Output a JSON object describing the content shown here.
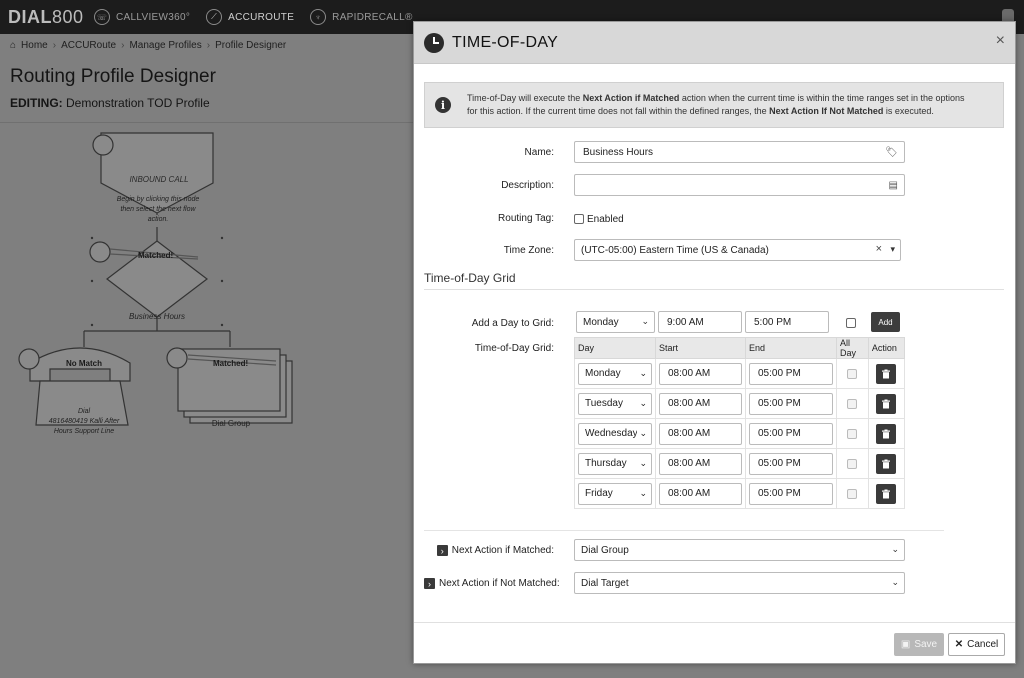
{
  "topbar": {
    "brand_a": "DIAL",
    "brand_b": "800",
    "nav": [
      {
        "label": "CALLVIEW360°",
        "icon": "callview-icon"
      },
      {
        "label": "ACCUROUTE",
        "icon": "accuroute-icon"
      },
      {
        "label": "RAPIDRECALL®",
        "icon": "rapidrecall-icon"
      }
    ]
  },
  "breadcrumb": [
    "Home",
    "ACCURoute",
    "Manage Profiles",
    "Profile Designer"
  ],
  "page": {
    "title": "Routing Profile Designer",
    "editing_label": "EDITING:",
    "editing_value": "Demonstration TOD Profile"
  },
  "flow": {
    "inbound_title": "INBOUND CALL",
    "inbound_text": [
      "Begin by clicking this node",
      "then select the next flow",
      "action."
    ],
    "matched_top": "Matched!",
    "decision_label": "Business Hours",
    "no_match": "No Match",
    "matched_right": "Matched!",
    "dial_text": [
      "Dial",
      "4816480419 Kalli After",
      "Hours Support Line"
    ],
    "dial_group": "Dial Group"
  },
  "modal": {
    "title": "TIME-OF-DAY",
    "close": "×",
    "info_1": "Time-of-Day will execute the ",
    "info_b1": "Next Action if Matched",
    "info_2": " action when the current time is within the time ranges set in the options",
    "info_3": "for this action. If the current time does not fall within the defined ranges, the ",
    "info_b2": "Next Action If Not Matched",
    "info_4": " is executed.",
    "name_label": "Name:",
    "name_value": "Business Hours",
    "desc_label": "Description:",
    "desc_value": "",
    "tag_label": "Routing Tag:",
    "tag_enabled": "Enabled",
    "tz_label": "Time Zone:",
    "tz_value": "(UTC-05:00) Eastern Time (US & Canada)",
    "tz_clear": "×",
    "section_title": "Time-of-Day Grid",
    "add_label": "Add a Day to Grid:",
    "add_day": "Monday",
    "add_start": "9:00 AM",
    "add_end": "5:00 PM",
    "add_button": "Add",
    "grid_label": "Time-of-Day Grid:",
    "grid_headers": [
      "Day",
      "Start",
      "End",
      "All Day",
      "Action"
    ],
    "grid_rows": [
      {
        "day": "Monday",
        "start": "08:00 AM",
        "end": "05:00 PM"
      },
      {
        "day": "Tuesday",
        "start": "08:00 AM",
        "end": "05:00 PM"
      },
      {
        "day": "Wednesday",
        "start": "08:00 AM",
        "end": "05:00 PM"
      },
      {
        "day": "Thursday",
        "start": "08:00 AM",
        "end": "05:00 PM"
      },
      {
        "day": "Friday",
        "start": "08:00 AM",
        "end": "05:00 PM"
      }
    ],
    "matched_label": "Next Action if Matched:",
    "matched_value": "Dial Group",
    "notmatched_label": "Next Action if Not Matched:",
    "notmatched_value": "Dial Target",
    "save": "Save",
    "cancel": "Cancel"
  }
}
